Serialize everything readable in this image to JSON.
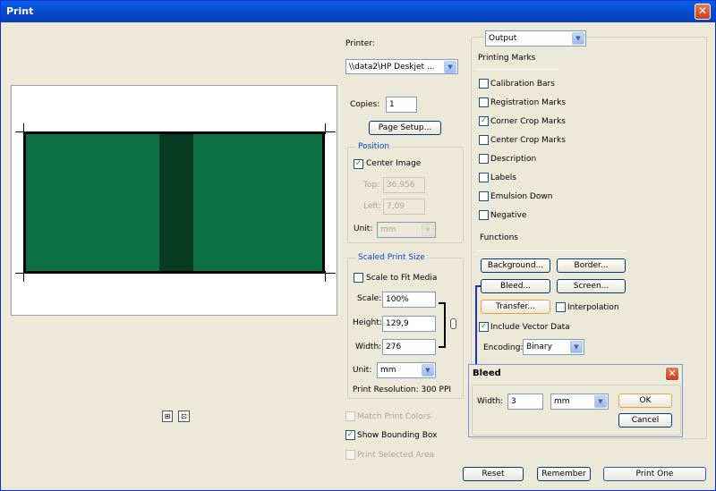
{
  "window": {
    "title": "Print",
    "close_glyph": "✕"
  },
  "preview": {
    "footer_icons": [
      "fit-icon",
      "zoom-icon"
    ]
  },
  "printer": {
    "label": "Printer:",
    "value": "\\\\data2\\HP Deskjet ..."
  },
  "copies": {
    "label": "Copies:",
    "value": "1"
  },
  "page_setup_button": "Page Setup...",
  "position": {
    "legend": "Position",
    "center_image": "Center Image",
    "center_image_checked": true,
    "top_label": "Top:",
    "top_value": "36,956",
    "left_label": "Left:",
    "left_value": "7,09",
    "unit_label": "Unit:",
    "unit_value": "mm"
  },
  "scaled": {
    "legend": "Scaled Print Size",
    "scale_to_fit": "Scale to Fit Media",
    "scale_label": "Scale:",
    "scale_value": "100%",
    "height_label": "Height:",
    "height_value": "129,9",
    "width_label": "Width:",
    "width_value": "276",
    "unit_label": "Unit:",
    "unit_value": "mm",
    "resolution": "Print Resolution: 300 PPI"
  },
  "options": {
    "match_print_colors": "Match Print Colors",
    "show_bounding_box": "Show Bounding Box",
    "show_bounding_box_checked": true,
    "print_selected_area": "Print Selected Area"
  },
  "output": {
    "dropdown": "Output",
    "printing_marks": "Printing Marks",
    "marks": [
      {
        "label": "Calibration Bars",
        "checked": false
      },
      {
        "label": "Registration Marks",
        "checked": false
      },
      {
        "label": "Corner Crop Marks",
        "checked": true
      },
      {
        "label": "Center Crop Marks",
        "checked": false
      },
      {
        "label": "Description",
        "checked": false
      },
      {
        "label": "Labels",
        "checked": false
      },
      {
        "label": "Emulsion Down",
        "checked": false
      },
      {
        "label": "Negative",
        "checked": false
      }
    ],
    "functions": "Functions",
    "background_button": "Background...",
    "border_button": "Border...",
    "bleed_button": "Bleed...",
    "screen_button": "Screen...",
    "transfer_button": "Transfer...",
    "interpolation": "Interpolation",
    "include_vector": "Include Vector Data",
    "include_vector_checked": true,
    "encoding_label": "Encoding:",
    "encoding_value": "Binary"
  },
  "bleed_dialog": {
    "title": "Bleed",
    "width_label": "Width:",
    "width_value": "3",
    "unit_value": "mm",
    "ok": "OK",
    "cancel": "Cancel"
  },
  "bottom": {
    "reset": "Reset",
    "remember": "Remember",
    "print_one": "Print One"
  },
  "colors": {
    "titlebar": "#0a5fe8",
    "image_green": "#0c7042",
    "accent_blue": "#0046d5"
  }
}
